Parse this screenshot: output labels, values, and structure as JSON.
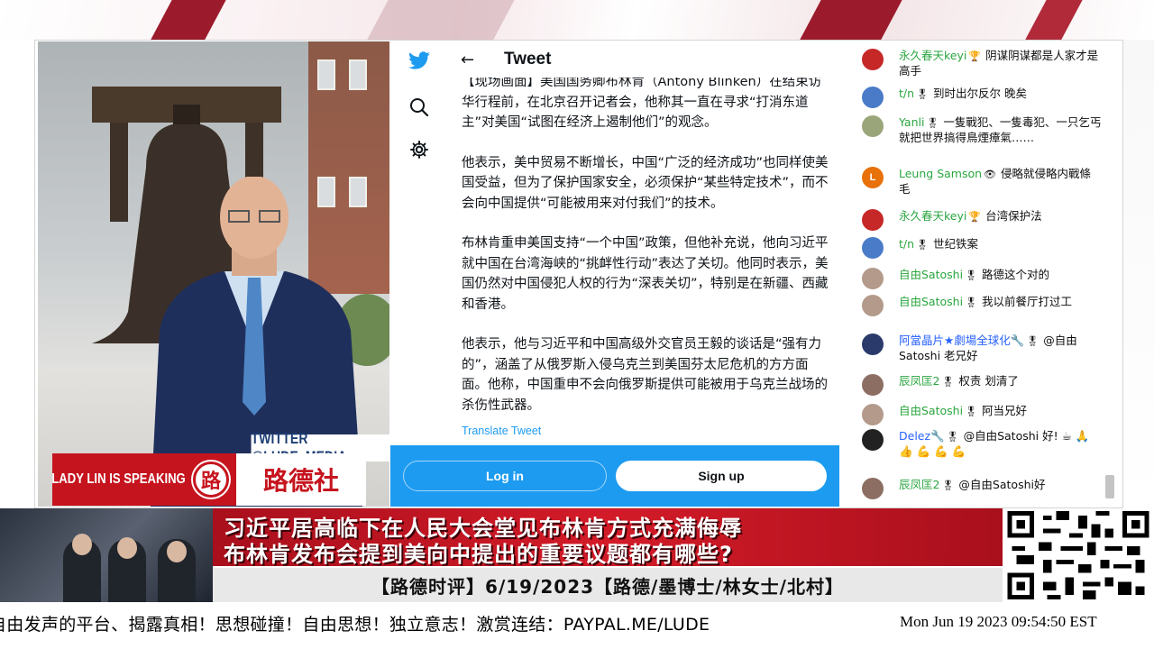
{
  "video": {
    "twitter_caption": "TWITTER  @LUDE_MEDIA",
    "lower_third_left": "LADY LIN IS SPEAKING",
    "logo_char": "路",
    "lower_third_right": "路德社"
  },
  "tweet": {
    "header_title": "Tweet",
    "paragraphs": [
      "【现场画面】美国国务卿布林肯（Antony Blinken）在结束访华行程前，在北京召开记者会，他称其一直在寻求“打消东道主”对美国“试图在经济上遏制他们”的观念。",
      "他表示，美中贸易不断增长，中国“广泛的经济成功”也同样使美国受益，但为了保护国家安全，必须保护“某些特定技术”，而不会向中国提供“可能被用来对付我们”的技术。",
      "布林肯重申美国支持“一个中国”政策，但他补充说，他向习近平就中国在台湾海峡的“挑衅性行动”表达了关切。他同时表示，美国仍然对中国侵犯人权的行为“深表关切”，特别是在新疆、西藏和香港。",
      "他表示，他与习近平和中国高级外交官员王毅的谈话是“强有力的”，涵盖了从俄罗斯入侵乌克兰到美国芬太尼危机的方方面面。他称，中国重申不会向俄罗斯提供可能被用于乌克兰战场的杀伤性武器。"
    ],
    "translate_link": "Translate Tweet",
    "login_label": "Log in",
    "signup_label": "Sign up"
  },
  "chat": {
    "messages": [
      {
        "name": "永久春天keyi",
        "badge": "🏆",
        "text": "阴谋阴谋都是人家才是高手",
        "avatar_color": "#c62828",
        "avatar_text": "",
        "name_color": "green"
      },
      {
        "name": "t/n",
        "badge": "🎖",
        "text": "到时出尔反尔 晚矣",
        "avatar_color": "#4a7bc8",
        "avatar_text": "",
        "name_color": "green"
      },
      {
        "name": "Yanli",
        "badge": "🎖",
        "text": "一隻戰犯、一隻毒犯、一只乞丐就把世界搞得鳥煙瘴氣……",
        "avatar_color": "#9aa57a",
        "avatar_text": "",
        "name_color": "green"
      },
      {
        "name": "Leung Samson",
        "badge": "👁",
        "text": "侵略就侵略内戰條毛",
        "avatar_color": "#e8710a",
        "avatar_text": "L",
        "name_color": "green"
      },
      {
        "name": "永久春天keyi",
        "badge": "🏆",
        "text": "台湾保护法",
        "avatar_color": "#c62828",
        "avatar_text": "",
        "name_color": "green"
      },
      {
        "name": "t/n",
        "badge": "🎖",
        "text": "世纪铁案",
        "avatar_color": "#4a7bc8",
        "avatar_text": "",
        "name_color": "green"
      },
      {
        "name": "自由Satoshi",
        "badge": "🎖",
        "text": "路德这个对的",
        "avatar_color": "#b39a8a",
        "avatar_text": "",
        "name_color": "green"
      },
      {
        "name": "自由Satoshi",
        "badge": "🎖",
        "text": "我以前餐厅打过工",
        "avatar_color": "#b39a8a",
        "avatar_text": "",
        "name_color": "green"
      },
      {
        "name": "阿當晶片★劇場全球化🔧",
        "badge": "🎖",
        "text": "@自由Satoshi 老兄好",
        "avatar_color": "#2a3a6a",
        "avatar_text": "",
        "name_color": "blue"
      },
      {
        "name": "辰凤匡2",
        "badge": "🎖",
        "text": "权责 划清了",
        "avatar_color": "#8d6e63",
        "avatar_text": "",
        "name_color": "green"
      },
      {
        "name": "自由Satoshi",
        "badge": "🎖",
        "text": "阿当兄好",
        "avatar_color": "#b39a8a",
        "avatar_text": "",
        "name_color": "green"
      },
      {
        "name": "Delez🔧",
        "badge": "🎖",
        "text": "@自由Satoshi 好! ☕ 🙏 👍 💪 💪 💪",
        "avatar_color": "#222222",
        "avatar_text": "",
        "name_color": "blue"
      },
      {
        "name": "辰凤匡2",
        "badge": "🎖",
        "text": "@自由Satoshi好",
        "avatar_color": "#8d6e63",
        "avatar_text": "",
        "name_color": "green"
      }
    ]
  },
  "banner": {
    "headline_1": "习近平居高临下在人民大会堂见布林肯方式充满侮辱",
    "headline_2": "布林肯发布会提到美向中提出的重要议题都有哪些?",
    "program_line": "【路德时评】6/19/2023【路德/墨博士/林女士/北村】"
  },
  "ticker": {
    "text": "自由发声的平台、揭露真相！思想碰撞！自由思想！独立意志！激赏连结：PAYPAL.ME/LUDE",
    "timestamp": "Mon Jun 19 2023 09:54:50 EST"
  },
  "colors": {
    "accent_red": "#c6141e",
    "twitter_blue": "#1d9bf0",
    "chat_name_green": "#2ba640",
    "chat_name_blue": "#2962ff"
  }
}
